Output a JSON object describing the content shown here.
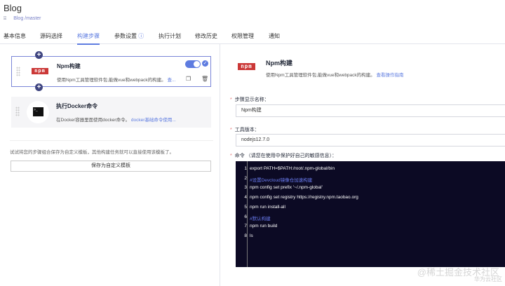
{
  "header": {
    "title": "Blog",
    "repo_icon": "repo-icon",
    "repo_link": "Blog /master"
  },
  "tabs": [
    {
      "label": "基本信息"
    },
    {
      "label": "源码选择"
    },
    {
      "label": "构建步骤",
      "active": true
    },
    {
      "label": "参数设置"
    },
    {
      "label": "执行计划"
    },
    {
      "label": "修改历史"
    },
    {
      "label": "权限管理"
    },
    {
      "label": "通知"
    }
  ],
  "steps": [
    {
      "logo": "npm",
      "title": "Npm构建",
      "desc": "使用Npm工具管理软件包,能做vue和webpack的构建。",
      "link": "查...",
      "enabled": true
    },
    {
      "title": "执行Docker命令",
      "desc": "在Docker容器里面使用docker命令。",
      "link": "docker基础命令使用..."
    }
  ],
  "hint": "试试将您的步骤组合保存为自定义模板，其他构建任务就可以直接使用该模板了。",
  "save_template_label": "保存为自定义模板",
  "detail": {
    "logo": "npm",
    "title": "Npm构建",
    "desc": "使用Npm工具管理软件包,能做vue和webpack的构建。",
    "guide_link": "查看操作指南",
    "name_label": "步骤显示名称：",
    "name_value": "Npm构建",
    "version_label": "工具版本：",
    "version_value": "nodejs12.7.0",
    "command_label": "命令 （请您在使用中保护好自己的敏感信息）：",
    "code_lines": [
      {
        "n": "1",
        "text": "export PATH=$PATH:/root/.npm-global/bin"
      },
      {
        "n": "2",
        "text": "#设置Devcloud镜像仓加速构建",
        "comment": true
      },
      {
        "n": "3",
        "text": "npm config set prefix '~/.npm-global'"
      },
      {
        "n": "4",
        "text": "npm config set registry https://registry.npm.taobao.org"
      },
      {
        "n": "5",
        "text": "npm run  install-all"
      },
      {
        "n": "6",
        "text": "#默认构建",
        "comment": true
      },
      {
        "n": "7",
        "text": "npm run  build"
      },
      {
        "n": "8",
        "text": "ls"
      }
    ]
  },
  "watermark": "@稀土掘金技术社区",
  "watermark2": "华为云社区",
  "colors": {
    "accent": "#5e7ce0",
    "npm": "#cb3837",
    "code_bg": "#0c0a24"
  }
}
